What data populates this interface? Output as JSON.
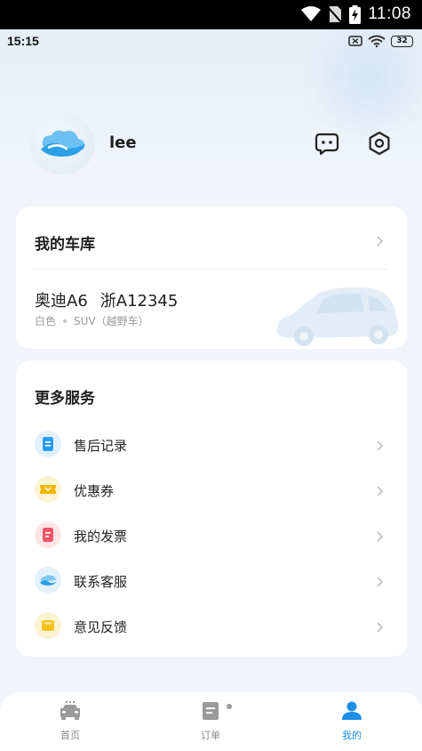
{
  "system_status": {
    "time": "11:08"
  },
  "app_status": {
    "time": "15:15",
    "battery": "32"
  },
  "profile": {
    "username": "lee",
    "avatar_icon": "cloud-wave-avatar-icon"
  },
  "garage": {
    "title": "我的车库",
    "car": {
      "brand_model": "奥迪A6",
      "plate": "浙A12345",
      "color": "白色",
      "type": "SUV（越野车）"
    }
  },
  "services": {
    "title": "更多服务",
    "items": [
      {
        "label": "售后记录",
        "icon": "document-icon",
        "color": "#2a9cf0"
      },
      {
        "label": "优惠券",
        "icon": "coupon-icon",
        "color": "#f2b705"
      },
      {
        "label": "我的发票",
        "icon": "invoice-icon",
        "color": "#f0566a"
      },
      {
        "label": "联系客服",
        "icon": "customer-service-icon",
        "color": "#38a6ec"
      },
      {
        "label": "意见反馈",
        "icon": "feedback-icon",
        "color": "#f6c21a"
      }
    ]
  },
  "tabs": [
    {
      "label": "首页",
      "icon": "car-icon",
      "active": false
    },
    {
      "label": "订单",
      "icon": "order-icon",
      "active": false
    },
    {
      "label": "我的",
      "icon": "user-icon",
      "active": true
    }
  ],
  "colors": {
    "accent": "#1e8fe9",
    "background": "#f2f5fa"
  }
}
